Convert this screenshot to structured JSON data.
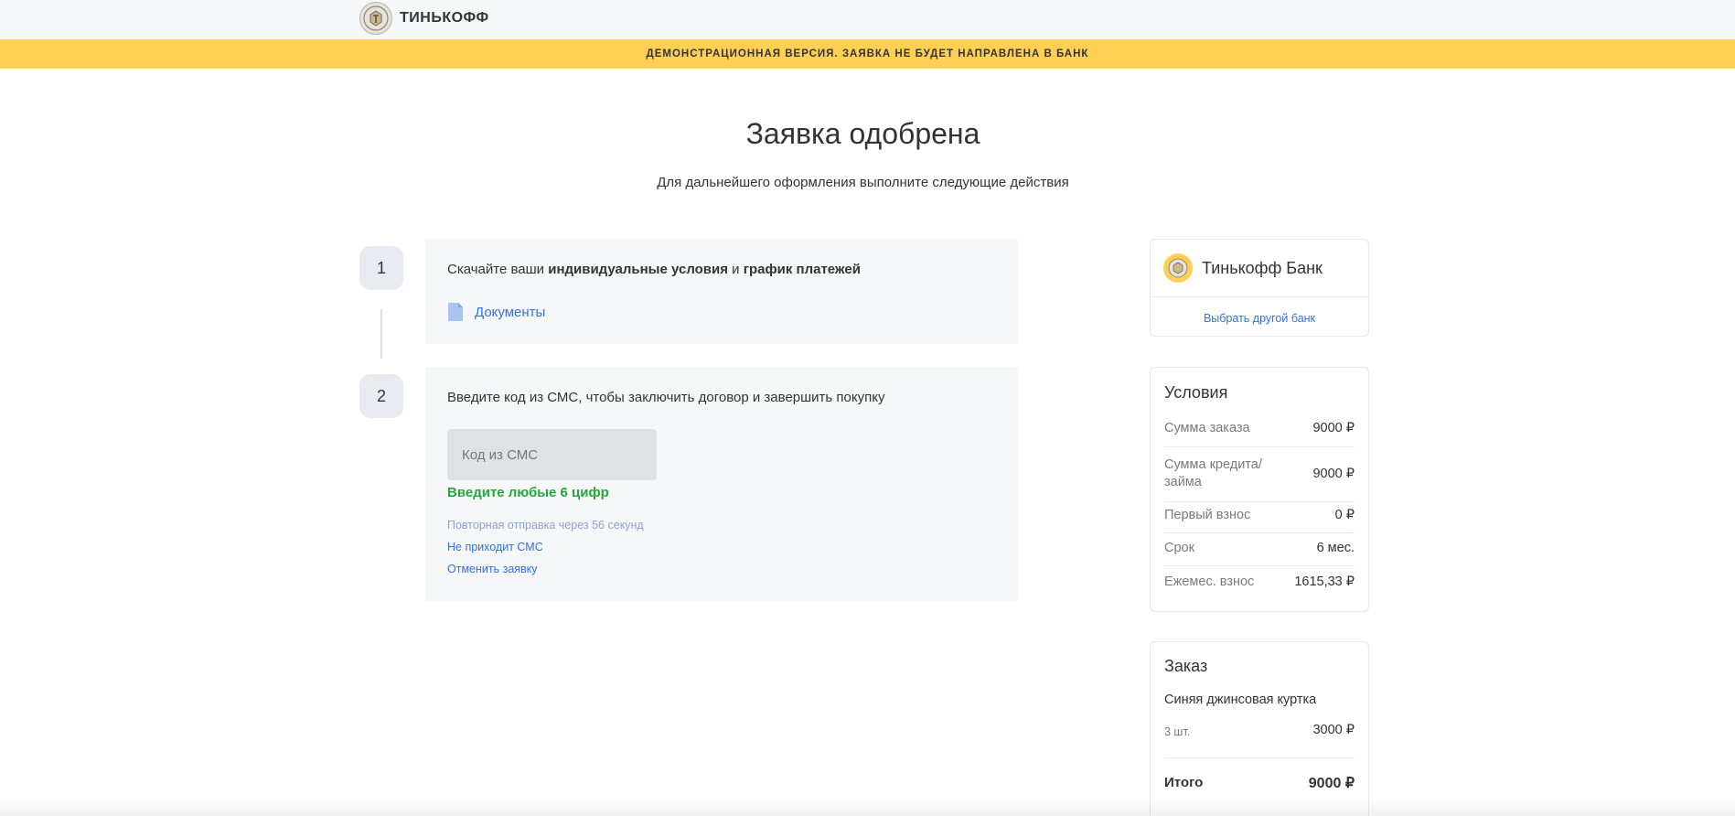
{
  "header": {
    "logo_text": "ТИНЬКОФФ",
    "logo_icon": "tinkoff-emblem-icon"
  },
  "banner": {
    "text": "ДЕМОНСТРАЦИОННАЯ ВЕРСИЯ. ЗАЯВКА НЕ БУДЕТ НАПРАВЛЕНА В БАНК",
    "color": "#ffd054"
  },
  "main": {
    "title": "Заявка одобрена",
    "subtitle": "Для дальнейшего оформления выполните следующие действия"
  },
  "steps": [
    {
      "number": "1",
      "text_prefix": "Скачайте ваши ",
      "text_bold1": "индивидуальные условия",
      "text_mid": " и ",
      "text_bold2": "график платежей",
      "link_icon": "document-icon",
      "link_label": "Документы"
    },
    {
      "number": "2",
      "text": "Введите код из СМС, чтобы заключить договор и завершить покупку",
      "input_placeholder": "Код из СМС",
      "input_value": "",
      "hint": "Введите любые 6 цифр",
      "resend_text": "Повторная отправка через 56 секунд",
      "no_sms_link": "Не приходит СМС",
      "cancel_link": "Отменить заявку"
    }
  ],
  "bank": {
    "name": "Тинькофф Банк",
    "change_link": "Выбрать другой банк"
  },
  "conditions": {
    "title": "Условия",
    "rows": [
      {
        "label": "Сумма заказа",
        "value": "9000 ₽"
      },
      {
        "label": "Сумма кредита/займа",
        "value": "9000 ₽"
      },
      {
        "label": "Первый взнос",
        "value": "0 ₽"
      },
      {
        "label": "Срок",
        "value": "6 мес."
      },
      {
        "label": "Ежемес. взнос",
        "value": "1615,33 ₽"
      }
    ]
  },
  "order": {
    "title": "Заказ",
    "item_name": "Синяя джинсовая куртка",
    "item_qty": "3 шт.",
    "item_price": "3000 ₽",
    "total_label": "Итого",
    "total_value": "9000 ₽"
  },
  "colors": {
    "accent_yellow": "#ffd054",
    "link_blue": "#336fee",
    "success_green": "#26a63c"
  }
}
